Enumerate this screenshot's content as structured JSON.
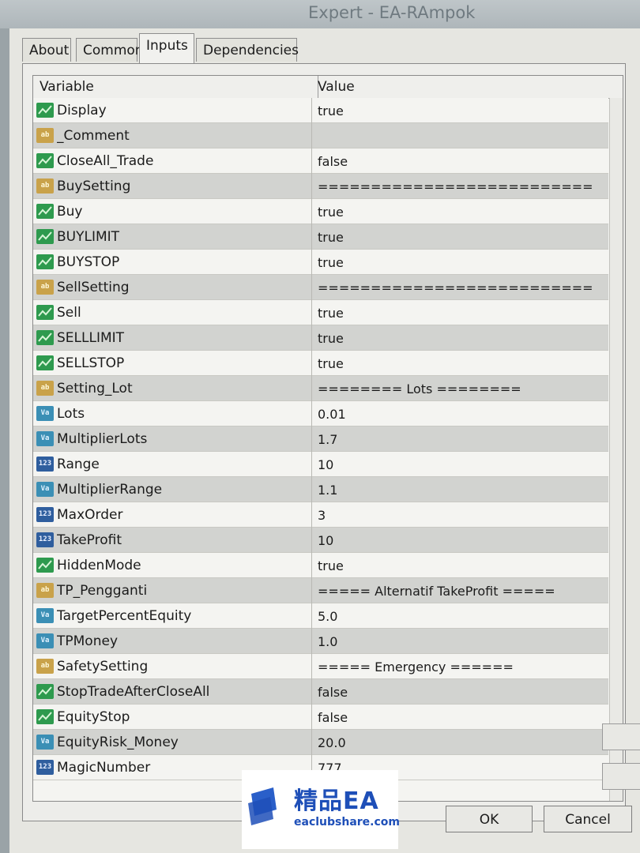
{
  "window": {
    "title": "Expert - EA-RAmpok"
  },
  "tabs": [
    {
      "label": "About"
    },
    {
      "label": "Common"
    },
    {
      "label": "Inputs"
    },
    {
      "label": "Dependencies"
    }
  ],
  "table": {
    "headers": {
      "variable": "Variable",
      "value": "Value"
    },
    "rows": [
      {
        "type": "bool",
        "name": "Display",
        "value": "true"
      },
      {
        "type": "string",
        "name": "_Comment",
        "value": ""
      },
      {
        "type": "bool",
        "name": "CloseAll_Trade",
        "value": "false"
      },
      {
        "type": "string",
        "name": "BuySetting",
        "value": "=========================="
      },
      {
        "type": "bool",
        "name": "Buy",
        "value": "true"
      },
      {
        "type": "bool",
        "name": "BUYLIMIT",
        "value": "true"
      },
      {
        "type": "bool",
        "name": "BUYSTOP",
        "value": "true"
      },
      {
        "type": "string",
        "name": "SellSetting",
        "value": "=========================="
      },
      {
        "type": "bool",
        "name": "Sell",
        "value": "true"
      },
      {
        "type": "bool",
        "name": "SELLLIMIT",
        "value": "true"
      },
      {
        "type": "bool",
        "name": "SELLSTOP",
        "value": "true"
      },
      {
        "type": "string",
        "name": "Setting_Lot",
        "value": "======== Lots ========"
      },
      {
        "type": "double",
        "name": "Lots",
        "value": "0.01"
      },
      {
        "type": "double",
        "name": "MultiplierLots",
        "value": "1.7"
      },
      {
        "type": "int",
        "name": "Range",
        "value": "10"
      },
      {
        "type": "double",
        "name": "MultiplierRange",
        "value": "1.1"
      },
      {
        "type": "int",
        "name": "MaxOrder",
        "value": "3"
      },
      {
        "type": "int",
        "name": "TakeProfit",
        "value": "10"
      },
      {
        "type": "bool",
        "name": "HiddenMode",
        "value": "true"
      },
      {
        "type": "string",
        "name": "TP_Pengganti",
        "value": "===== Alternatif TakeProfit ====="
      },
      {
        "type": "double",
        "name": "TargetPercentEquity",
        "value": "5.0"
      },
      {
        "type": "double",
        "name": "TPMoney",
        "value": "1.0"
      },
      {
        "type": "string",
        "name": "SafetySetting",
        "value": "===== Emergency ======"
      },
      {
        "type": "bool",
        "name": "StopTradeAfterCloseAll",
        "value": "false"
      },
      {
        "type": "bool",
        "name": "EquityStop",
        "value": "false"
      },
      {
        "type": "double",
        "name": "EquityRisk_Money",
        "value": "20.0"
      },
      {
        "type": "int",
        "name": "MagicNumber",
        "value": "777"
      }
    ]
  },
  "type_icons": {
    "bool": "ab-bool-icon",
    "string": "ab",
    "double": "Va",
    "int": "123"
  },
  "buttons": {
    "ok": "OK",
    "cancel": "Cancel"
  },
  "watermark": {
    "brand": "精品EA",
    "url": "eaclubshare.com"
  }
}
